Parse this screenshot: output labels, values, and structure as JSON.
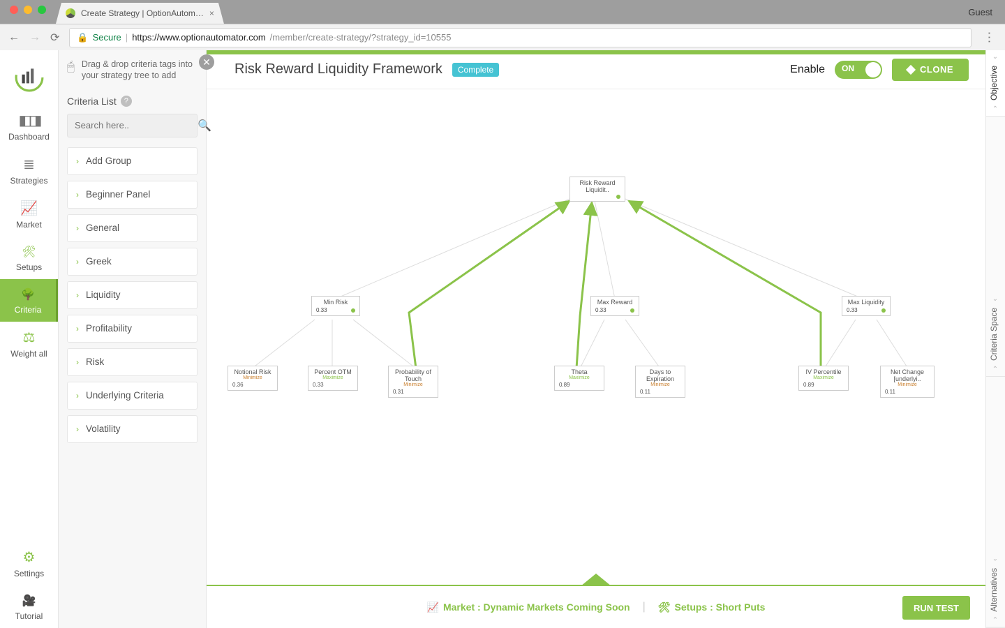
{
  "browser": {
    "tab_title": "Create Strategy | OptionAutom…",
    "guest": "Guest",
    "secure": "Secure",
    "url_host": "https://www.optionautomator.com",
    "url_path": "/member/create-strategy/?strategy_id=10555"
  },
  "rail": {
    "items": [
      {
        "key": "dashboard",
        "label": "Dashboard"
      },
      {
        "key": "strategies",
        "label": "Strategies"
      },
      {
        "key": "market",
        "label": "Market"
      },
      {
        "key": "setups",
        "label": "Setups"
      },
      {
        "key": "criteria",
        "label": "Criteria"
      },
      {
        "key": "weight",
        "label": "Weight all"
      }
    ],
    "bottom": [
      {
        "key": "settings",
        "label": "Settings"
      },
      {
        "key": "tutorial",
        "label": "Tutorial"
      }
    ]
  },
  "panel": {
    "hint": "Drag & drop criteria tags into your strategy tree to add",
    "title": "Criteria List",
    "search_placeholder": "Search here..",
    "items": [
      "Add Group",
      "Beginner Panel",
      "General",
      "Greek",
      "Liquidity",
      "Profitability",
      "Risk",
      "Underlying Criteria",
      "Volatility"
    ]
  },
  "header": {
    "title": "Risk Reward Liquidity Framework",
    "badge": "Complete",
    "enable": "Enable",
    "toggle": "ON",
    "clone": "CLONE"
  },
  "tree": {
    "root": {
      "title": "Risk Reward Liquidit..",
      "dot": true
    },
    "groups": [
      {
        "title": "Min Risk",
        "weight": "0.33"
      },
      {
        "title": "Max Reward",
        "weight": "0.33"
      },
      {
        "title": "Max Liquidity",
        "weight": "0.33"
      }
    ],
    "leaves": [
      {
        "title": "Notional Risk",
        "dir": "Minimize",
        "weight": "0.36"
      },
      {
        "title": "Percent OTM",
        "dir": "Maximize",
        "weight": "0.33"
      },
      {
        "title": "Probability of Touch",
        "dir": "Minimize",
        "weight": "0.31"
      },
      {
        "title": "Theta",
        "dir": "Maximize",
        "weight": "0.89"
      },
      {
        "title": "Days to Expiration",
        "dir": "Minimize",
        "weight": "0.11"
      },
      {
        "title": "IV Percentile",
        "dir": "Maximize",
        "weight": "0.89"
      },
      {
        "title": "Net Change [underlyi..",
        "dir": "Minimize",
        "weight": "0.11"
      }
    ]
  },
  "footer": {
    "market": "Market : Dynamic Markets Coming Soon",
    "setups": "Setups : Short Puts",
    "run": "RUN TEST"
  },
  "vtabs": {
    "a": "Objective",
    "b": "Criteria Space",
    "c": "Alternatives"
  }
}
